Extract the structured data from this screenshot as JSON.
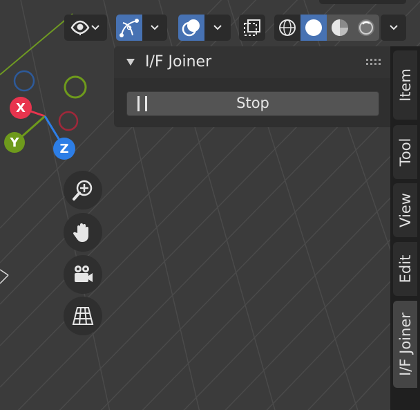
{
  "panel": {
    "title": "I/F Joiner",
    "stop_button": {
      "label": "Stop"
    }
  },
  "sidebar_tabs": [
    {
      "label": "Item",
      "active": false
    },
    {
      "label": "Tool",
      "active": false
    },
    {
      "label": "View",
      "active": false
    },
    {
      "label": "Edit",
      "active": false
    },
    {
      "label": "I/F Joiner",
      "active": true
    }
  ],
  "gizmo": {
    "x": "X",
    "y": "Y",
    "z": "Z"
  },
  "header_tools": [
    {
      "name": "visibility-icon",
      "has_dropdown": true
    },
    {
      "name": "gizmo-icon",
      "has_dropdown": true,
      "active": true
    },
    {
      "name": "overlay-icon",
      "has_dropdown": true,
      "active": true
    },
    {
      "name": "xray-icon"
    },
    {
      "name": "shading-wireframe-icon"
    },
    {
      "name": "shading-solid-icon",
      "active": true
    },
    {
      "name": "shading-material-icon"
    },
    {
      "name": "shading-rendered-icon"
    }
  ],
  "nav_buttons": [
    "zoom-icon",
    "hand-icon",
    "camera-icon",
    "ortho-grid-icon"
  ],
  "colors": {
    "background": "#3b3b3b",
    "accent": "#4772b3",
    "axis_x": "#e8344e",
    "axis_y": "#6e9a1c",
    "axis_z": "#2d7ee6"
  }
}
